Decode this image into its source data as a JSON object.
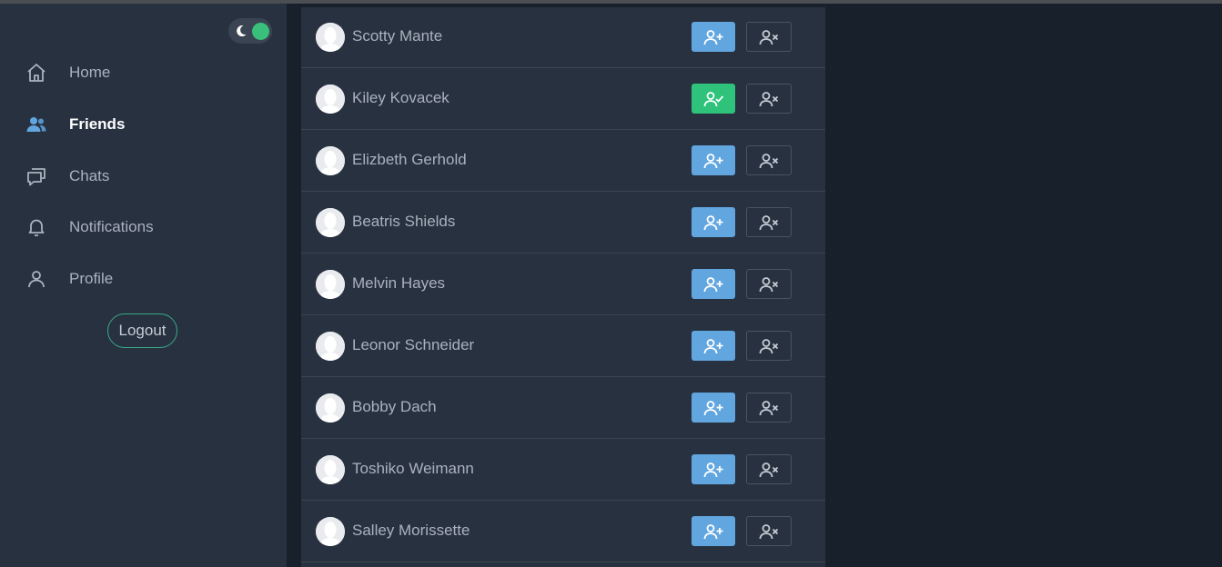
{
  "theme": {
    "toggle_icon": "moon-icon",
    "toggle_on_color": "#3ac07a"
  },
  "sidebar": {
    "items": [
      {
        "label": "Home",
        "icon": "home-icon",
        "active": false
      },
      {
        "label": "Friends",
        "icon": "users-icon",
        "active": true
      },
      {
        "label": "Chats",
        "icon": "chat-icon",
        "active": false
      },
      {
        "label": "Notifications",
        "icon": "bell-icon",
        "active": false
      },
      {
        "label": "Profile",
        "icon": "user-icon",
        "active": false
      }
    ],
    "logout_label": "Logout"
  },
  "friends": [
    {
      "name": "Scotty Mante",
      "status": "add"
    },
    {
      "name": "Kiley Kovacek",
      "status": "accepted"
    },
    {
      "name": "Elizbeth Gerhold",
      "status": "add"
    },
    {
      "name": "Beatris Shields",
      "status": "add"
    },
    {
      "name": "Melvin Hayes",
      "status": "add"
    },
    {
      "name": "Leonor Schneider",
      "status": "add"
    },
    {
      "name": "Bobby Dach",
      "status": "add"
    },
    {
      "name": "Toshiko Weimann",
      "status": "add"
    },
    {
      "name": "Salley Morissette",
      "status": "add"
    }
  ],
  "colors": {
    "accent_blue": "#62a6e0",
    "accent_green": "#2ec27a",
    "sidebar_bg": "#273140",
    "page_bg": "#18202b"
  }
}
